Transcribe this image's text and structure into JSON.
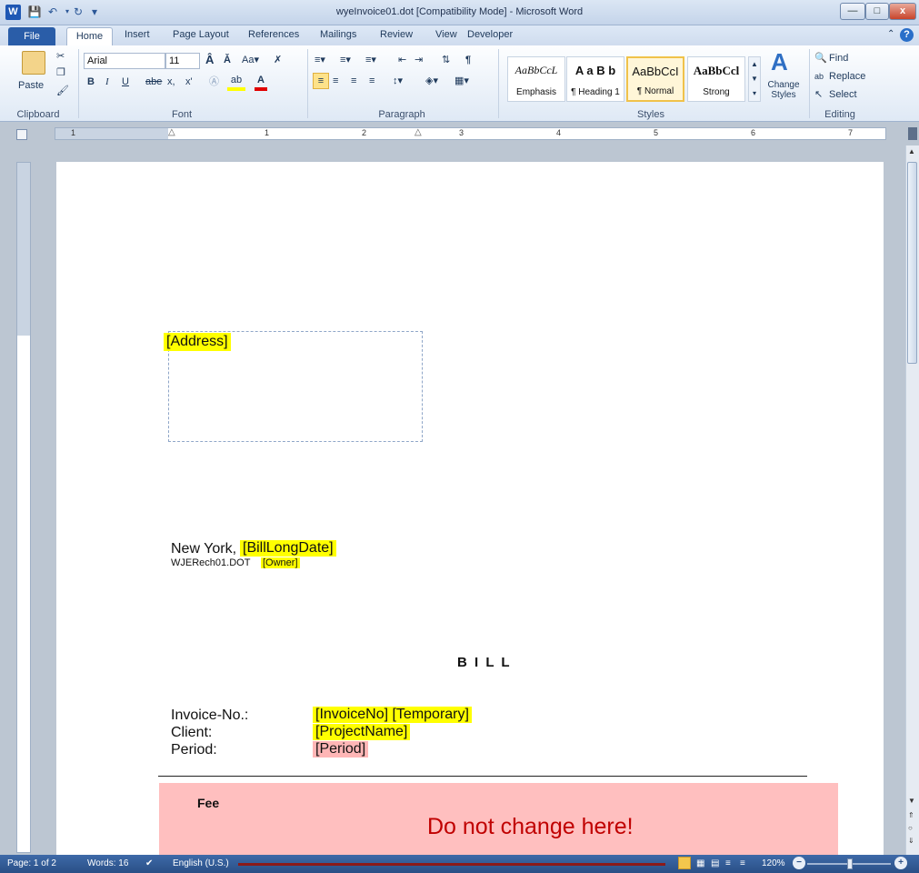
{
  "window": {
    "title": "wyeInvoice01.dot [Compatibility Mode] - Microsoft Word",
    "app_letter": "W"
  },
  "tabs": [
    "File",
    "Home",
    "Insert",
    "Page Layout",
    "References",
    "Mailings",
    "Review",
    "View",
    "Developer"
  ],
  "ribbon": {
    "clipboard": {
      "paste": "Paste",
      "label": "Clipboard"
    },
    "font": {
      "name": "Arial",
      "size": "11",
      "label": "Font",
      "bold": "B",
      "italic": "I",
      "underline": "U",
      "strike": "abe",
      "subscript": "x,",
      "superscript": "x'"
    },
    "paragraph": {
      "label": "Paragraph",
      "pilcrow": "¶"
    },
    "styles": {
      "label": "Styles",
      "items": [
        {
          "sample": "AaBbCcL",
          "name": "Emphasis"
        },
        {
          "sample": "A a B b",
          "name": "¶ Heading 1"
        },
        {
          "sample": "AaBbCcI",
          "name": "¶ Normal"
        },
        {
          "sample": "AaBbCcl",
          "name": "Strong"
        }
      ],
      "change_styles": "Change Styles"
    },
    "editing": {
      "find": "Find",
      "replace": "Replace",
      "select": "Select",
      "label": "Editing"
    }
  },
  "ruler": {
    "marks": [
      "1",
      "1",
      "2",
      "3",
      "4",
      "5",
      "6",
      "7"
    ]
  },
  "document": {
    "address": "[Address]",
    "city": "New York,",
    "bill_long_date": "[BillLongDate]",
    "file_ref": "WJERech01.DOT",
    "owner": "[Owner]",
    "heading": "B I L L",
    "invoice_label": "Invoice-No.:",
    "invoice_value": "[InvoiceNo] [Temporary]",
    "client_label": "Client:",
    "client_value": "[ProjectName]",
    "period_label": "Period:",
    "period_value": "[Period]",
    "fee_label": "Fee",
    "warning": "Do not change here!"
  },
  "status": {
    "page": "Page: 1 of 2",
    "words": "Words: 16",
    "language": "English (U.S.)",
    "zoom": "120%"
  },
  "colors": {
    "highlight_yellow": "#ffff00",
    "highlight_pink": "#ffb6b6",
    "warning_red": "#c00000",
    "file_tab": "#2a5da8"
  }
}
